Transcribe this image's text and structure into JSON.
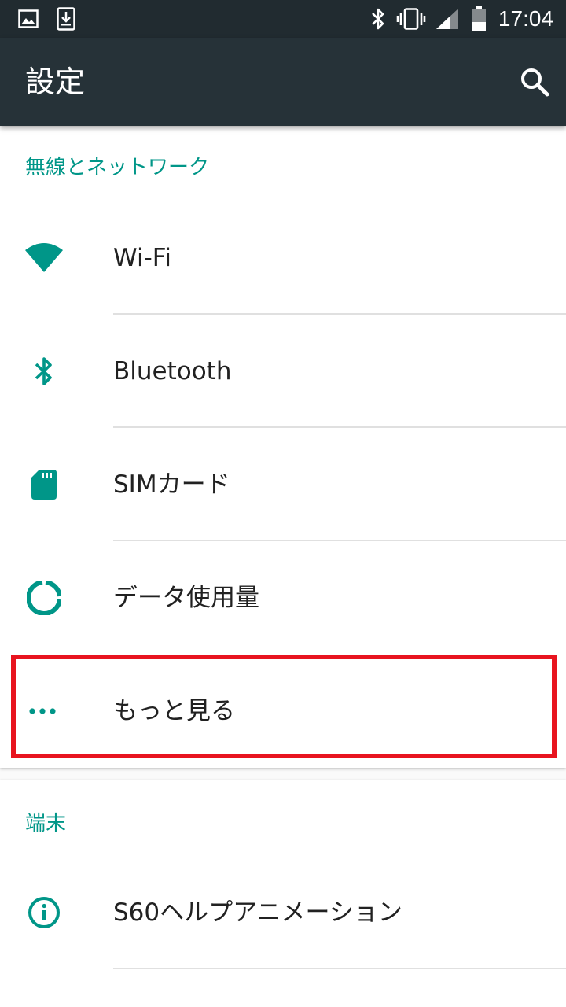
{
  "status_bar": {
    "time": "17:04",
    "left_icons": [
      "image-icon",
      "download-icon"
    ],
    "right_icons": [
      "bluetooth-icon",
      "vibrate-icon",
      "signal-icon",
      "battery-icon"
    ]
  },
  "app_bar": {
    "title": "設定",
    "search_icon": "search-icon"
  },
  "colors": {
    "accent": "#009688",
    "app_bar": "#263238",
    "status_bar": "#212b30",
    "highlight": "#e8141f"
  },
  "sections": [
    {
      "header": "無線とネットワーク",
      "items": [
        {
          "label": "Wi-Fi",
          "icon": "wifi-icon"
        },
        {
          "label": "Bluetooth",
          "icon": "bluetooth-icon"
        },
        {
          "label": "SIMカード",
          "icon": "sim-card-icon"
        },
        {
          "label": "データ使用量",
          "icon": "data-usage-icon"
        },
        {
          "label": "もっと見る",
          "icon": "more-icon"
        }
      ]
    },
    {
      "header": "端末",
      "items": [
        {
          "label": "S60ヘルプアニメーション",
          "icon": "info-icon"
        }
      ]
    }
  ]
}
